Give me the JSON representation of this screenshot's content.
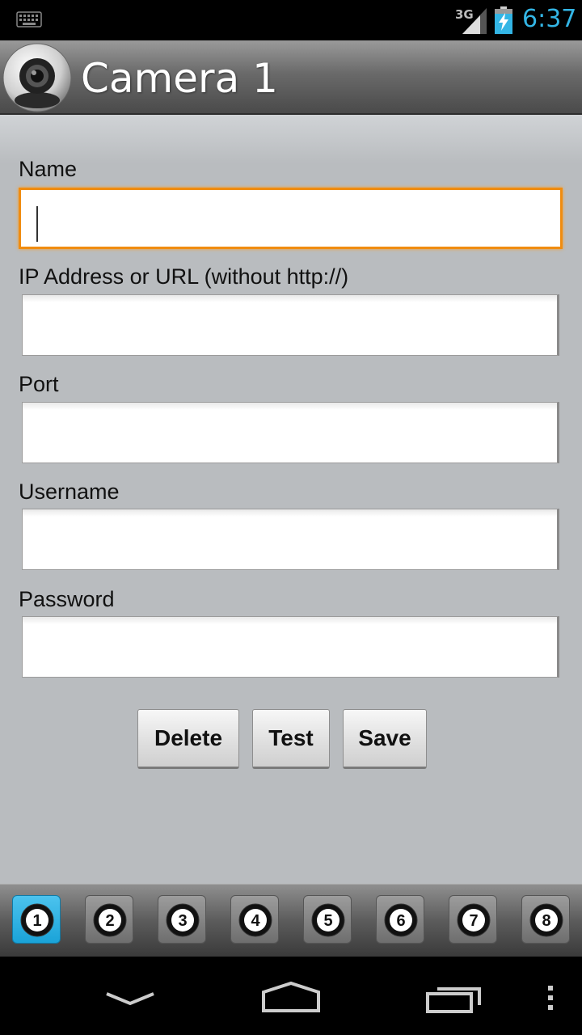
{
  "status_bar": {
    "network_label": "3G",
    "time": "6:37",
    "icons": [
      "keyboard-icon",
      "signal-icon",
      "battery-charging-icon"
    ]
  },
  "title_bar": {
    "title": "Camera 1",
    "icon": "webcam-icon"
  },
  "form": {
    "name": {
      "label": "Name",
      "value": ""
    },
    "address": {
      "label": "IP Address or URL (without http://)",
      "value": ""
    },
    "port": {
      "label": "Port",
      "value": ""
    },
    "username": {
      "label": "Username",
      "value": ""
    },
    "password": {
      "label": "Password",
      "value": ""
    }
  },
  "buttons": {
    "delete": "Delete",
    "test": "Test",
    "save": "Save"
  },
  "camera_selector": {
    "items": [
      "1",
      "2",
      "3",
      "4",
      "5",
      "6",
      "7",
      "8"
    ],
    "active_index": 0
  },
  "nav_bar": {
    "icons": [
      "back-icon",
      "home-icon",
      "recent-apps-icon",
      "menu-icon"
    ]
  },
  "colors": {
    "accent_clock": "#33b5e5",
    "focus_border": "#f08c10",
    "active_camera": "#1aa3d8"
  }
}
